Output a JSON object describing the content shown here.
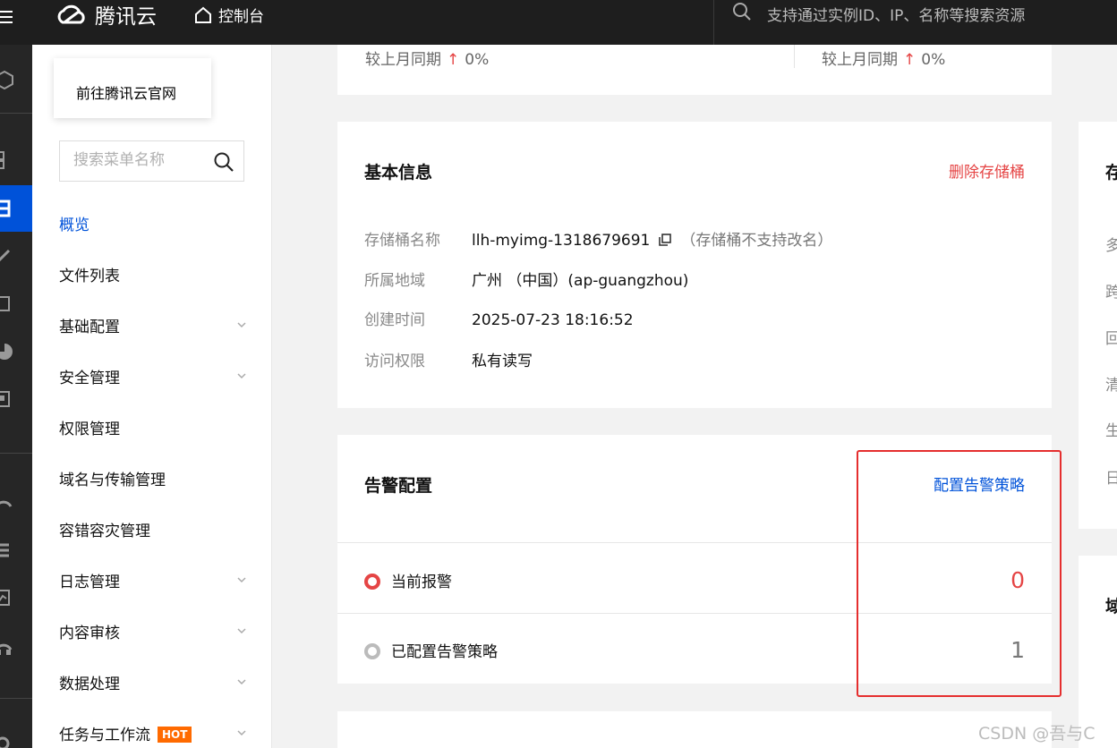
{
  "topbar": {
    "brand": "腾讯云",
    "console_label": "控制台",
    "search_placeholder": "支持通过实例ID、IP、名称等搜索资源"
  },
  "sidebar": {
    "tooltip": "前往腾讯云官网",
    "search_placeholder": "搜索菜单名称",
    "items": [
      {
        "label": "概览"
      },
      {
        "label": "文件列表"
      },
      {
        "label": "基础配置"
      },
      {
        "label": "安全管理"
      },
      {
        "label": "权限管理"
      },
      {
        "label": "域名与传输管理"
      },
      {
        "label": "容错容灾管理"
      },
      {
        "label": "日志管理"
      },
      {
        "label": "内容审核"
      },
      {
        "label": "数据处理"
      },
      {
        "label": "任务与工作流",
        "badge": "HOT"
      }
    ]
  },
  "top_card": {
    "compare_left": {
      "label": "较上月同期",
      "arrow": "↑",
      "value": "0%"
    },
    "compare_right": {
      "label": "较上月同期",
      "arrow": "↑",
      "value": "0%"
    }
  },
  "basic_info": {
    "title": "基本信息",
    "delete_link": "删除存储桶",
    "rows": [
      {
        "key": "存储桶名称",
        "value": "llh-myimg-1318679691",
        "hint": "（存储桶不支持改名）"
      },
      {
        "key": "所属地域",
        "value": "广州 （中国）(ap-guangzhou)"
      },
      {
        "key": "创建时间",
        "value": "2025-07-23 18:16:52"
      },
      {
        "key": "访问权限",
        "value": "私有读写"
      }
    ]
  },
  "alarm": {
    "title": "告警配置",
    "config_link": "配置告警策略",
    "rows": [
      {
        "label": "当前报警",
        "count": "0"
      },
      {
        "label": "已配置告警策略",
        "count": "1"
      }
    ]
  },
  "right_card": {
    "title_char": "存",
    "chars": [
      "多",
      "跨",
      "回",
      "清",
      "生",
      "日"
    ],
    "second_title_char": "域"
  },
  "watermark": "CSDN @吾与C",
  "colors": {
    "accent": "#0052d9",
    "danger": "#e54545",
    "topbar": "#1e1e1e",
    "highlight": "#e52e2e"
  }
}
